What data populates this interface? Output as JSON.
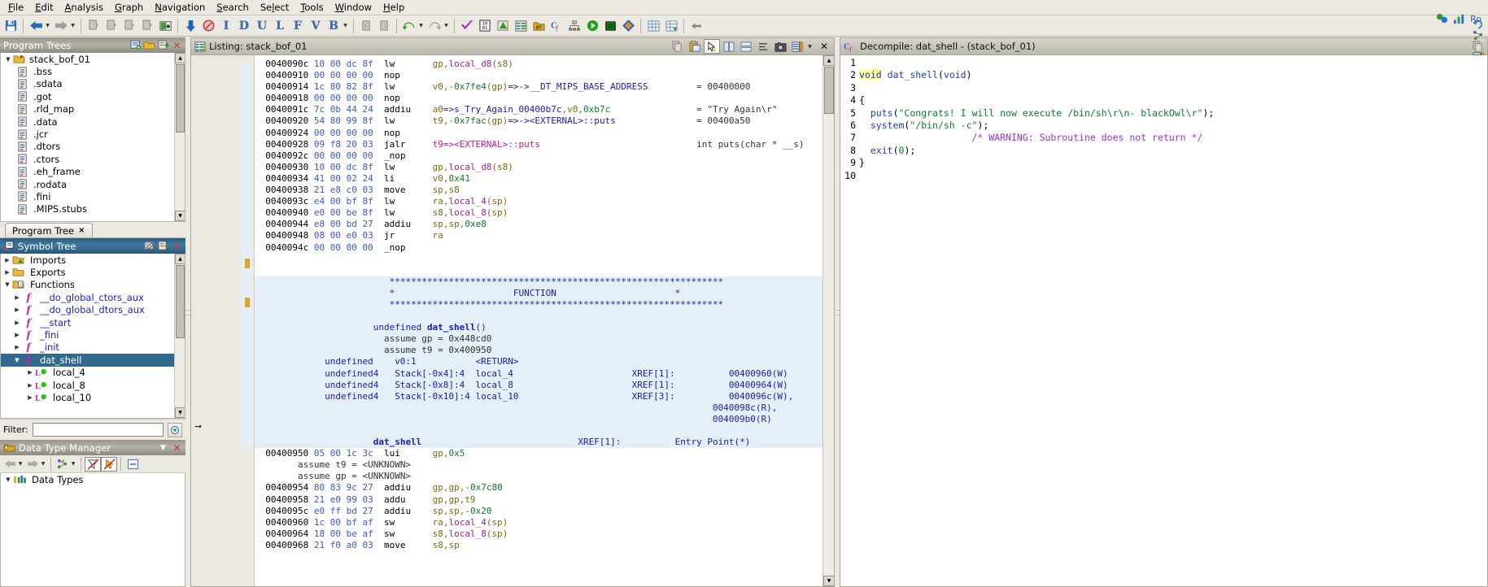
{
  "app": {
    "title": "Ghidra CodeBrowser"
  },
  "menubar": {
    "items": [
      {
        "label": "File",
        "mnemonic": "F"
      },
      {
        "label": "Edit",
        "mnemonic": "E"
      },
      {
        "label": "Analysis",
        "mnemonic": "A"
      },
      {
        "label": "Graph",
        "mnemonic": "G"
      },
      {
        "label": "Navigation",
        "mnemonic": "N"
      },
      {
        "label": "Search",
        "mnemonic": "S"
      },
      {
        "label": "Select",
        "mnemonic": "l"
      },
      {
        "label": "Tools",
        "mnemonic": "T"
      },
      {
        "label": "Window",
        "mnemonic": "W"
      },
      {
        "label": "Help",
        "mnemonic": "H"
      }
    ]
  },
  "toolbar": {
    "groups": [
      {
        "buttons": [
          {
            "icon": "save-icon",
            "glyph": "💾"
          }
        ]
      },
      {
        "buttons": [
          {
            "icon": "back-arrow-icon",
            "glyph": "⬅",
            "dropdown": true
          },
          {
            "icon": "forward-arrow-icon",
            "glyph": "➡",
            "dropdown": true
          }
        ]
      },
      {
        "buttons": [
          {
            "icon": "next-code-unit-icon",
            "glyph": "⬇"
          },
          {
            "icon": "next-instruction-icon",
            "glyph": "⬇"
          },
          {
            "icon": "next-data-icon",
            "glyph": "⬇"
          },
          {
            "icon": "next-undefined-icon",
            "glyph": "⬇"
          },
          {
            "icon": "snapshot-icon",
            "glyph": "📷"
          }
        ]
      },
      {
        "buttons": [
          {
            "icon": "down-arrow-icon",
            "glyph": "⬇"
          },
          {
            "icon": "no-entry-icon",
            "glyph": "⛔"
          },
          {
            "icon": "instruction-letter-icon",
            "letter": "I"
          },
          {
            "icon": "data-letter-icon",
            "letter": "D"
          },
          {
            "icon": "undefined-letter-icon",
            "letter": "U"
          },
          {
            "icon": "label-letter-icon",
            "letter": "L"
          },
          {
            "icon": "function-letter-icon",
            "letter": "F"
          },
          {
            "icon": "bookmark-v-letter-icon",
            "letter": "V"
          },
          {
            "icon": "bookmark-b-letter-icon",
            "letter": "B",
            "dropdown": true
          }
        ]
      },
      {
        "buttons": [
          {
            "icon": "import-icon",
            "glyph": "📥"
          },
          {
            "icon": "export-icon",
            "glyph": "📤"
          }
        ]
      },
      {
        "buttons": [
          {
            "icon": "undo-icon",
            "glyph": "↶",
            "dropdown": true
          },
          {
            "icon": "redo-icon",
            "glyph": "↷",
            "dropdown": true
          }
        ]
      },
      {
        "buttons": [
          {
            "icon": "check-icon",
            "glyph": "✔"
          },
          {
            "icon": "hex-toggle-icon",
            "glyph": "🔢"
          },
          {
            "icon": "memory-map-icon",
            "glyph": "🗺"
          },
          {
            "icon": "symbol-table-icon",
            "glyph": "📑"
          },
          {
            "icon": "data-type-manager-icon",
            "glyph": "📁"
          },
          {
            "icon": "decompiler-icon",
            "glyph": "Cf"
          },
          {
            "icon": "function-graph-icon",
            "glyph": "⛓"
          },
          {
            "icon": "run-icon",
            "glyph": "▶"
          },
          {
            "icon": "processor-icon",
            "glyph": "🔲"
          },
          {
            "icon": "diamond-icon",
            "glyph": "◆"
          }
        ]
      },
      {
        "buttons": [
          {
            "icon": "table-icon",
            "glyph": "▦"
          },
          {
            "icon": "table-export-icon",
            "glyph": "▦"
          }
        ]
      },
      {
        "buttons": [
          {
            "icon": "left-arrow-small-icon",
            "glyph": "←"
          }
        ]
      }
    ]
  },
  "program_trees": {
    "title": "Program Trees",
    "header_icons": [
      "new-tree-icon",
      "open-folder-icon",
      "collapse-tree-icon",
      "close-panel-icon"
    ],
    "root": "stack_bof_01",
    "items": [
      {
        "label": ".bss"
      },
      {
        "label": ".sdata"
      },
      {
        "label": ".got"
      },
      {
        "label": ".rld_map"
      },
      {
        "label": ".data"
      },
      {
        "label": ".jcr"
      },
      {
        "label": ".dtors"
      },
      {
        "label": ".ctors"
      },
      {
        "label": ".eh_frame"
      },
      {
        "label": ".rodata"
      },
      {
        "label": ".fini"
      },
      {
        "label": ".MIPS.stubs"
      }
    ],
    "tab": {
      "label": "Program Tree",
      "close": "×"
    }
  },
  "symbol_tree": {
    "title": "Symbol Tree",
    "header_icons": [
      "rename-icon",
      "collapse-tree-icon",
      "close-panel-icon"
    ],
    "nodes": [
      {
        "label": "Imports",
        "type": "folder",
        "expanded": false,
        "indent": 1
      },
      {
        "label": "Exports",
        "type": "folder",
        "expanded": false,
        "indent": 1
      },
      {
        "label": "Functions",
        "type": "folder-fn",
        "expanded": true,
        "indent": 1
      },
      {
        "label": "__do_global_ctors_aux",
        "type": "fn",
        "expanded": false,
        "indent": 2
      },
      {
        "label": "__do_global_dtors_aux",
        "type": "fn",
        "expanded": false,
        "indent": 2
      },
      {
        "label": "__start",
        "type": "fn",
        "expanded": false,
        "indent": 2
      },
      {
        "label": "_fini",
        "type": "fn",
        "expanded": false,
        "indent": 2
      },
      {
        "label": "_init",
        "type": "fn",
        "expanded": false,
        "indent": 2
      },
      {
        "label": "dat_shell",
        "type": "fn",
        "expanded": true,
        "indent": 2,
        "selected": true
      },
      {
        "label": "local_4",
        "type": "local",
        "expanded": false,
        "indent": 3
      },
      {
        "label": "local_8",
        "type": "local",
        "expanded": false,
        "indent": 3
      },
      {
        "label": "local_10",
        "type": "local",
        "expanded": false,
        "indent": 3
      }
    ],
    "filter": {
      "label": "Filter:",
      "value": "",
      "placeholder": ""
    }
  },
  "data_type_manager": {
    "title": "Data Type Manager",
    "header_icons": [
      "menu-down-icon",
      "close-panel-icon"
    ],
    "toolbar_icons": [
      "back-arrow-icon",
      "forward-arrow-icon",
      "dt-graph-icon",
      "filter-off-icon",
      "no-pointer-icon",
      "collapse-icon"
    ],
    "root": "Data Types"
  },
  "listing": {
    "title": "Listing:  stack_bof_01",
    "title_icon": "listing-icon",
    "header_icons": [
      "copy-icon",
      "paste-icon",
      "cursor-icon",
      "diff-icon",
      "multi-listing-icon",
      "align-icon",
      "camera-icon",
      "listing-options-icon",
      "menu-down-icon",
      "close-panel-icon"
    ],
    "rows": [
      {
        "addr": "0040090c",
        "bytes": "10 00 dc 8f",
        "mnem": "lw",
        "ops": [
          {
            "t": "reg",
            "v": "gp,"
          },
          {
            "t": "var",
            "v": "local_d8"
          },
          {
            "t": "reg",
            "v": "(s8)"
          }
        ],
        "cmt": ""
      },
      {
        "addr": "00400910",
        "bytes": "00 00 00 00",
        "mnem": "nop",
        "ops": [],
        "cmt": ""
      },
      {
        "addr": "00400914",
        "bytes": "1c 80 82 8f",
        "mnem": "lw",
        "ops": [
          {
            "t": "reg",
            "v": "v0,"
          },
          {
            "t": "num",
            "v": "-0x7fe4"
          },
          {
            "t": "reg",
            "v": "(gp)"
          },
          {
            "t": "sym",
            "v": "=>->__DT_MIPS_BASE_ADDRESS"
          }
        ],
        "cmt": "= 00400000"
      },
      {
        "addr": "00400918",
        "bytes": "00 00 00 00",
        "mnem": "nop",
        "ops": [],
        "cmt": ""
      },
      {
        "addr": "0040091c",
        "bytes": "7c 0b 44 24",
        "mnem": "addiu",
        "ops": [
          {
            "t": "reg",
            "v": "a0"
          },
          {
            "t": "sym",
            "v": "=>s_Try_Again_00400b7c"
          },
          {
            "t": "reg",
            "v": ",v0,"
          },
          {
            "t": "num",
            "v": "0xb7c"
          }
        ],
        "cmt": "= \"Try Again\\r\""
      },
      {
        "addr": "00400920",
        "bytes": "54 80 99 8f",
        "mnem": "lw",
        "ops": [
          {
            "t": "reg",
            "v": "t9,"
          },
          {
            "t": "num",
            "v": "-0x7fac"
          },
          {
            "t": "reg",
            "v": "(gp)"
          },
          {
            "t": "sym",
            "v": "=>-><EXTERNAL>::puts"
          }
        ],
        "cmt": "= 00400a50"
      },
      {
        "addr": "00400924",
        "bytes": "00 00 00 00",
        "mnem": "nop",
        "ops": [],
        "cmt": ""
      },
      {
        "addr": "00400928",
        "bytes": "09 f8 20 03",
        "mnem": "jalr",
        "ops": [
          {
            "t": "call",
            "v": "t9=><EXTERNAL>::puts"
          }
        ],
        "cmt": "int puts(char * __s)"
      },
      {
        "addr": "0040092c",
        "bytes": "00 00 00 00",
        "mnem": "_nop",
        "ops": [],
        "cmt": ""
      },
      {
        "addr": "00400930",
        "bytes": "10 00 dc 8f",
        "mnem": "lw",
        "ops": [
          {
            "t": "reg",
            "v": "gp,"
          },
          {
            "t": "var",
            "v": "local_d8"
          },
          {
            "t": "reg",
            "v": "(s8)"
          }
        ],
        "cmt": ""
      },
      {
        "addr": "00400934",
        "bytes": "41 00 02 24",
        "mnem": "li",
        "ops": [
          {
            "t": "reg",
            "v": "v0,"
          },
          {
            "t": "num",
            "v": "0x41"
          }
        ],
        "cmt": ""
      },
      {
        "addr": "00400938",
        "bytes": "21 e8 c0 03",
        "mnem": "move",
        "ops": [
          {
            "t": "reg",
            "v": "sp,s8"
          }
        ],
        "cmt": ""
      },
      {
        "addr": "0040093c",
        "bytes": "e4 00 bf 8f",
        "mnem": "lw",
        "ops": [
          {
            "t": "reg",
            "v": "ra,"
          },
          {
            "t": "var",
            "v": "local_4"
          },
          {
            "t": "reg",
            "v": "(sp)"
          }
        ],
        "cmt": ""
      },
      {
        "addr": "00400940",
        "bytes": "e0 00 be 8f",
        "mnem": "lw",
        "ops": [
          {
            "t": "reg",
            "v": "s8,"
          },
          {
            "t": "var",
            "v": "local_8"
          },
          {
            "t": "reg",
            "v": "(sp)"
          }
        ],
        "cmt": ""
      },
      {
        "addr": "00400944",
        "bytes": "e8 00 bd 27",
        "mnem": "addiu",
        "ops": [
          {
            "t": "reg",
            "v": "sp,sp,"
          },
          {
            "t": "num",
            "v": "0xe8"
          }
        ],
        "cmt": ""
      },
      {
        "addr": "00400948",
        "bytes": "08 00 e0 03",
        "mnem": "jr",
        "ops": [
          {
            "t": "reg",
            "v": "ra"
          }
        ],
        "cmt": ""
      },
      {
        "addr": "0040094c",
        "bytes": "00 00 00 00",
        "mnem": "_nop",
        "ops": [],
        "cmt": ""
      }
    ],
    "function_banner": {
      "star_line": "**************************************************************",
      "mid_prefix": "*",
      "mid_label": "FUNCTION",
      "mid_suffix": "*"
    },
    "signature": "undefined dat_shell()",
    "signature_name": "dat_shell",
    "assumptions": [
      "assume gp = 0x448cd0",
      "assume t9 = 0x400950"
    ],
    "vars": [
      {
        "type": "undefined",
        "name": "",
        "storage": "v0:1",
        "label": "<RETURN>",
        "xref": "",
        "xaddrs": []
      },
      {
        "type": "undefined4",
        "name": "",
        "storage": "Stack[-0x4]:4",
        "label": "local_4",
        "xref": "XREF[1]:",
        "xaddrs": [
          "00400960(W)"
        ]
      },
      {
        "type": "undefined4",
        "name": "",
        "storage": "Stack[-0x8]:4",
        "label": "local_8",
        "xref": "XREF[1]:",
        "xaddrs": [
          "00400964(W)"
        ]
      },
      {
        "type": "undefined4",
        "name": "",
        "storage": "Stack[-0x10]:4",
        "label": "local_10",
        "xref": "XREF[3]:",
        "xaddrs": [
          "0040096c(W),",
          "0040098c(R),",
          "004009b0(R)"
        ]
      }
    ],
    "entry_label": "dat_shell",
    "entry_xref": "XREF[1]:",
    "entry_point": "Entry Point(*)",
    "rows2": [
      {
        "addr": "00400950",
        "bytes": "05 00 1c 3c",
        "mnem": "lui",
        "ops": [
          {
            "t": "reg",
            "v": "gp,"
          },
          {
            "t": "num",
            "v": "0x5"
          }
        ],
        "cmt": ""
      },
      {
        "assume": "assume t9 = <UNKNOWN>"
      },
      {
        "assume": "assume gp = <UNKNOWN>"
      },
      {
        "addr": "00400954",
        "bytes": "80 83 9c 27",
        "mnem": "addiu",
        "ops": [
          {
            "t": "reg",
            "v": "gp,gp,"
          },
          {
            "t": "num",
            "v": "-0x7c80"
          }
        ],
        "cmt": ""
      },
      {
        "addr": "00400958",
        "bytes": "21 e0 99 03",
        "mnem": "addu",
        "ops": [
          {
            "t": "reg",
            "v": "gp,gp,t9"
          }
        ],
        "cmt": ""
      },
      {
        "addr": "0040095c",
        "bytes": "e0 ff bd 27",
        "mnem": "addiu",
        "ops": [
          {
            "t": "reg",
            "v": "sp,sp,"
          },
          {
            "t": "num",
            "v": "-0x20"
          }
        ],
        "cmt": ""
      },
      {
        "addr": "00400960",
        "bytes": "1c 00 bf af",
        "mnem": "sw",
        "ops": [
          {
            "t": "reg",
            "v": "ra,"
          },
          {
            "t": "var",
            "v": "local_4"
          },
          {
            "t": "reg",
            "v": "(sp)"
          }
        ],
        "cmt": ""
      },
      {
        "addr": "00400964",
        "bytes": "18 00 be af",
        "mnem": "sw",
        "ops": [
          {
            "t": "reg",
            "v": "s8,"
          },
          {
            "t": "var",
            "v": "local_8"
          },
          {
            "t": "reg",
            "v": "(sp)"
          }
        ],
        "cmt": ""
      },
      {
        "addr": "00400968",
        "bytes": "21 f0 a0 03",
        "mnem": "move",
        "ops": [
          {
            "t": "reg",
            "v": "s8,sp"
          }
        ],
        "cmt": ""
      }
    ]
  },
  "decompiler": {
    "title": "Decompile: dat_shell - (stack_bof_01)",
    "title_icon": "decompiler-cf-icon",
    "header_icons": [
      "refresh-icon",
      "graph-icon",
      "copy-icon",
      "export-icon",
      "menu-down-icon",
      "close-panel-icon"
    ],
    "lines": [
      {
        "n": "1",
        "tokens": []
      },
      {
        "n": "2",
        "tokens": [
          {
            "t": "type-hl",
            "v": "void"
          },
          {
            "t": "plain",
            "v": " "
          },
          {
            "t": "fn",
            "v": "dat_shell"
          },
          {
            "t": "punct",
            "v": "("
          },
          {
            "t": "type",
            "v": "void"
          },
          {
            "t": "punct",
            "v": ")"
          }
        ]
      },
      {
        "n": "3",
        "tokens": []
      },
      {
        "n": "4",
        "tokens": [
          {
            "t": "punct",
            "v": "{"
          }
        ]
      },
      {
        "n": "5",
        "tokens": [
          {
            "t": "plain",
            "v": "  "
          },
          {
            "t": "call",
            "v": "puts"
          },
          {
            "t": "punct",
            "v": "("
          },
          {
            "t": "str",
            "v": "\"Congrats! I will now execute /bin/sh\\r\\n- blackOwl\\r\""
          },
          {
            "t": "punct",
            "v": ");"
          }
        ]
      },
      {
        "n": "6",
        "tokens": [
          {
            "t": "plain",
            "v": "  "
          },
          {
            "t": "call",
            "v": "system"
          },
          {
            "t": "punct",
            "v": "("
          },
          {
            "t": "str",
            "v": "\"/bin/sh -c\""
          },
          {
            "t": "punct",
            "v": ");"
          }
        ]
      },
      {
        "n": "7",
        "tokens": [
          {
            "t": "plain",
            "v": "                    "
          },
          {
            "t": "warn",
            "v": "/* WARNING: Subroutine does not return */"
          }
        ]
      },
      {
        "n": "8",
        "tokens": [
          {
            "t": "plain",
            "v": "  "
          },
          {
            "t": "call",
            "v": "exit"
          },
          {
            "t": "punct",
            "v": "("
          },
          {
            "t": "num",
            "v": "0"
          },
          {
            "t": "punct",
            "v": ");"
          }
        ]
      },
      {
        "n": "9",
        "tokens": [
          {
            "t": "punct",
            "v": "}"
          }
        ]
      },
      {
        "n": "10",
        "tokens": []
      }
    ],
    "right_icons": [
      "snapshot-icon",
      "graph-icon",
      "ro-label"
    ],
    "ro_label": "Ro"
  }
}
